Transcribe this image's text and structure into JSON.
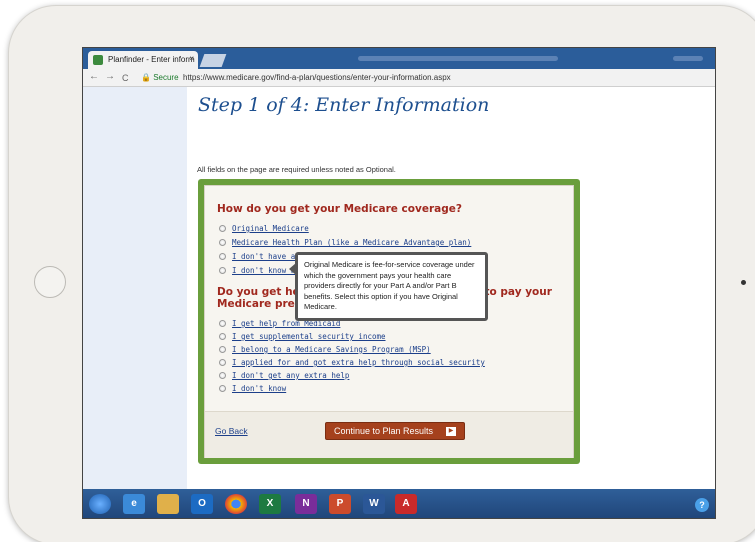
{
  "browser": {
    "tab_title": "Planfinder - Enter inform",
    "tab_close": "×",
    "secure_label": "Secure",
    "url": "https://www.medicare.gov/find-a-plan/questions/enter-your-information.aspx",
    "nav": {
      "back": "←",
      "forward": "→",
      "reload": "C"
    }
  },
  "page": {
    "title": "Step 1 of 4: Enter Information",
    "required_note": "All fields on the page are required unless noted as Optional."
  },
  "question1": {
    "heading": "How do you get your Medicare coverage?",
    "options": [
      "Original Medicare",
      "Medicare Health Plan (like a Medicare Advantage plan)",
      "I don't have any Medicare coverage",
      "I don't know what coverage I have"
    ]
  },
  "tooltip": {
    "text": "Original Medicare is fee-for-service coverage under which the government pays your health care providers directly for your Part A and/or Part B benefits. Select this option if you have Original Medicare."
  },
  "question2": {
    "heading_line1": "Do you get help from Medicare or your state to pay your",
    "heading_line2": "Medicare prescription drug costs?",
    "options": [
      "I get help from Medicaid",
      "I get supplemental security income",
      "I belong to a Medicare Savings Program (MSP)",
      "I applied for and got extra help through social security",
      "I don't get any extra help",
      "I don't know"
    ]
  },
  "footer": {
    "go_back": "Go Back",
    "continue": "Continue to Plan Results",
    "continue_arrow": "▶"
  },
  "taskbar": {
    "icons": [
      "windows-start",
      "internet-explorer",
      "file-explorer",
      "outlook",
      "chrome",
      "excel",
      "onenote",
      "powerpoint",
      "word",
      "acrobat",
      "help"
    ],
    "labels": {
      "outlook": "O",
      "excel": "X",
      "onenote": "N",
      "powerpoint": "P",
      "word": "W",
      "acrobat": "A",
      "ie": "e",
      "help": "?"
    }
  }
}
